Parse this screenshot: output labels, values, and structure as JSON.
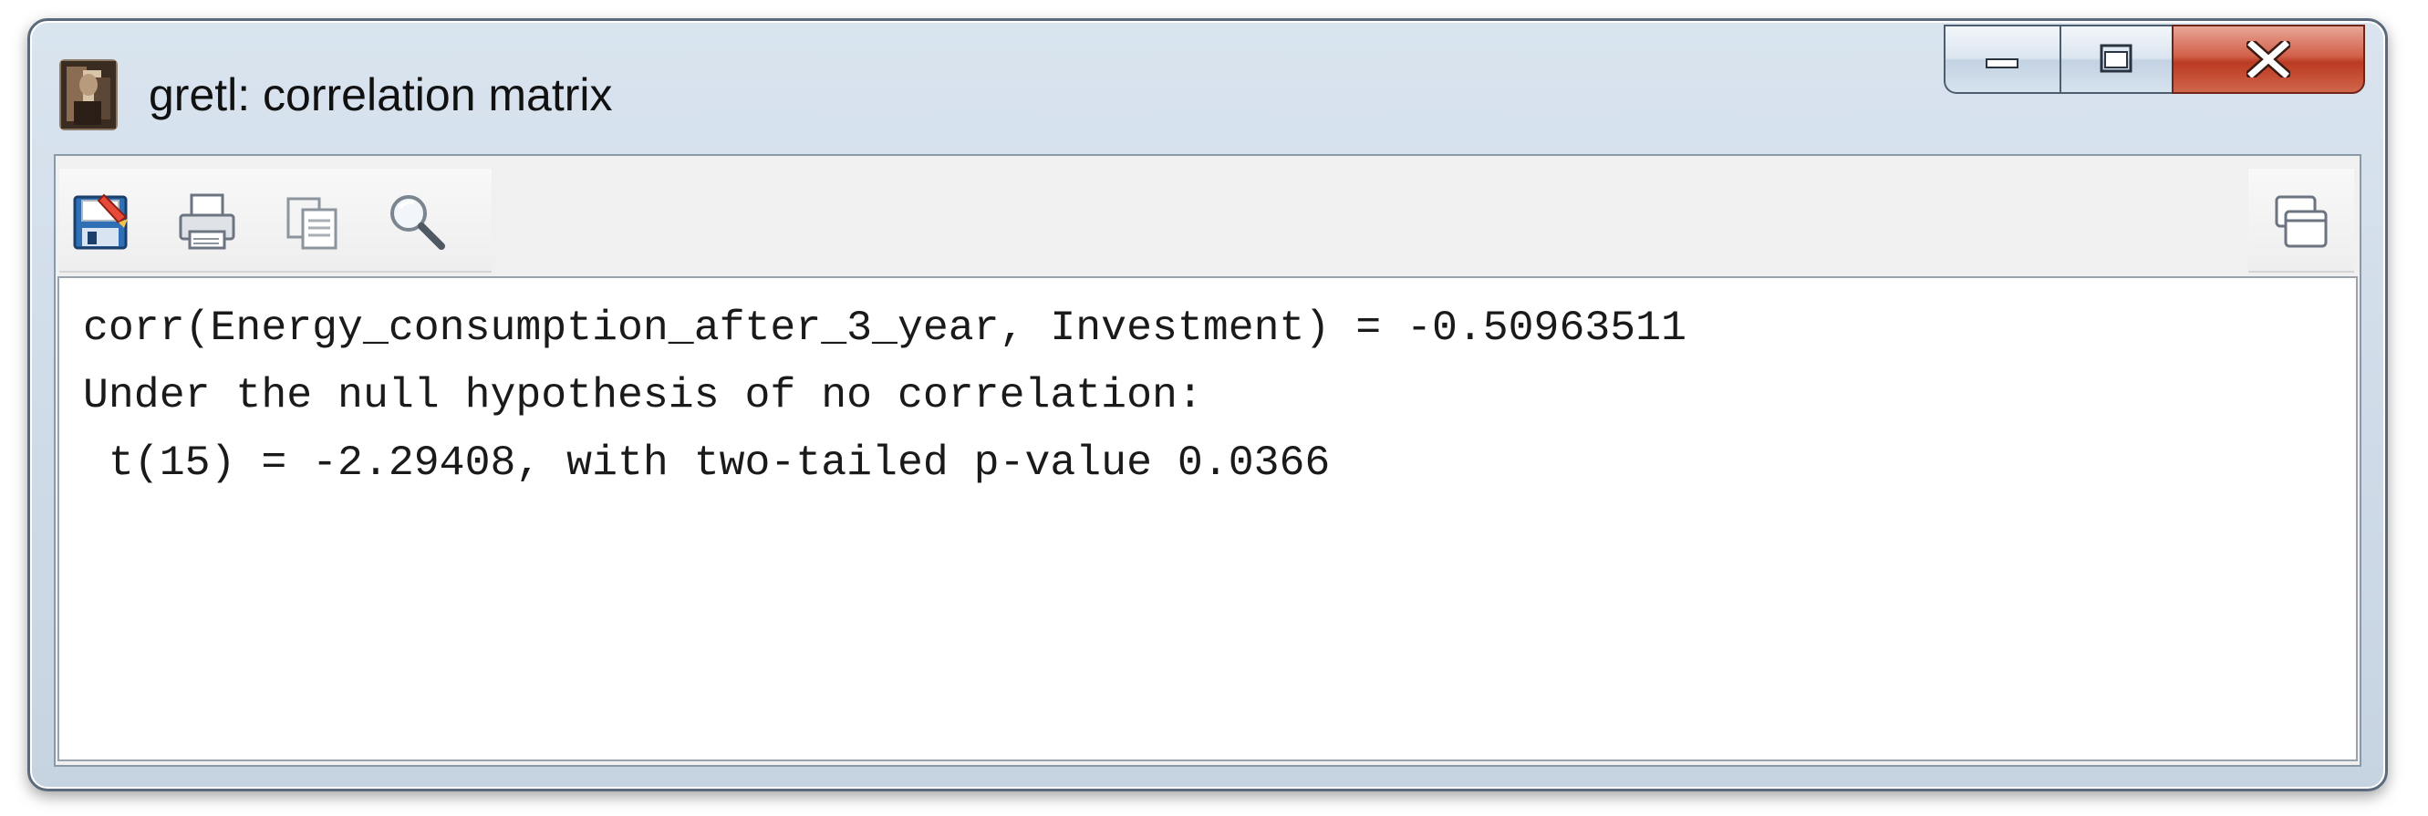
{
  "window": {
    "title": "gretl: correlation matrix"
  },
  "caption_buttons": {
    "minimize_icon": "minimize-icon",
    "maximize_icon": "maximize-icon",
    "close_icon": "close-icon"
  },
  "toolbar": {
    "items": [
      {
        "icon": "save-icon"
      },
      {
        "icon": "print-icon"
      },
      {
        "icon": "copy-icon"
      },
      {
        "icon": "find-icon"
      }
    ],
    "right_items": [
      {
        "icon": "windows-list-icon"
      }
    ]
  },
  "output": {
    "lines": [
      "corr(Energy_consumption_after_3_year, Investment) = -0.50963511",
      "Under the null hypothesis of no correlation:",
      " t(15) = -2.29408, with two-tailed p-value 0.0366"
    ]
  }
}
